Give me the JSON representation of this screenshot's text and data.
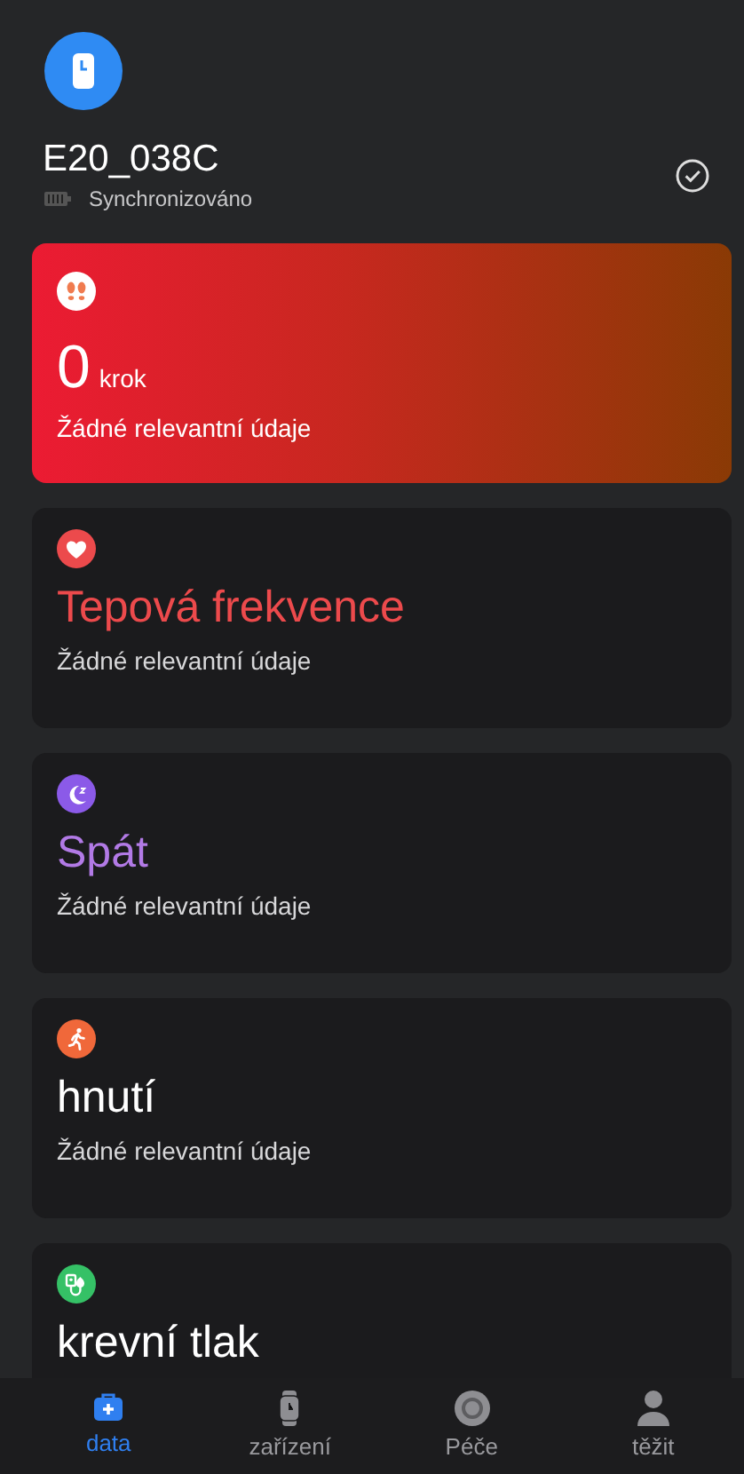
{
  "device": {
    "name": "E20_038C",
    "status": "Synchronizováno",
    "synced": true
  },
  "steps_card": {
    "value": "0",
    "unit": "krok",
    "note": "Žádné relevantní údaje"
  },
  "metric_cards": [
    {
      "kind": "heart",
      "title": "Tepová frekvence",
      "note": "Žádné relevantní údaje",
      "color": "#ec4a4c",
      "accent_title": true
    },
    {
      "kind": "sleep",
      "title": "Spát",
      "note": "Žádné relevantní údaje",
      "color": "#8b5ae8",
      "accent_title": true
    },
    {
      "kind": "run",
      "title": "hnutí",
      "note": "Žádné relevantní údaje",
      "color": "#f0683a",
      "accent_title": false
    },
    {
      "kind": "pressure",
      "title": "krevní tlak",
      "color": "#35c166",
      "accent_title": false
    }
  ],
  "tabs": [
    {
      "kind": "kit",
      "label": "data",
      "selected": true
    },
    {
      "kind": "watch",
      "label": "zařízení",
      "selected": false
    },
    {
      "kind": "ring",
      "label": "Péče",
      "selected": false
    },
    {
      "kind": "person",
      "label": "těžit",
      "selected": false
    }
  ]
}
